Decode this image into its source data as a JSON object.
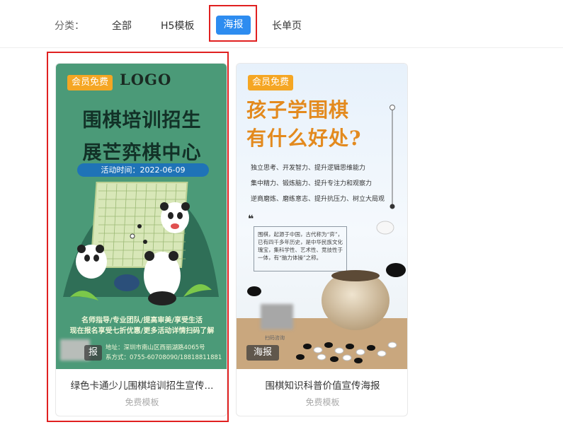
{
  "filter": {
    "label": "分类：",
    "tabs": [
      "全部",
      "H5模板",
      "海报",
      "长单页"
    ],
    "active": "海报"
  },
  "colors": {
    "accent": "#2d8cf0",
    "highlight": "#e02020",
    "badge": "#f5a623"
  },
  "cards": [
    {
      "badge": "会员免费",
      "type_tag": "报",
      "title": "绿色卡通少儿围棋培训招生宣传...",
      "subtitle": "免费模板",
      "poster": {
        "logo": "LOGO",
        "title_line1": "围棋培训招生",
        "title_line2": "展芒弈棋中心",
        "date": "活动时间：2022-06-09",
        "desc_line1": "名师指导/专业团队/提高审美/享受生活",
        "desc_line2": "现在报名享受七折优惠/更多活动详情扫码了解",
        "info_line1": "地址：深圳市南山区西丽湖路4065号",
        "info_line2": "系方式：0755-60708090/18818811881"
      }
    },
    {
      "badge": "会员免费",
      "type_tag": "海报",
      "title": "围棋知识科普价值宣传海报",
      "subtitle": "免费模板",
      "poster": {
        "title_line1": "孩子学围棋",
        "title_line2": "有什么好处?",
        "line1": "独立思考、开发智力、提升逻辑思维能力",
        "line2": "集中精力、锻炼脑力、提升专注力和观察力",
        "line3": "逆商磨炼、磨练意志、提升抗压力、树立大局观",
        "quote": "❝",
        "paragraph": "围棋，起源于中国，古代称为“弈”，已有四千多年历史，是中华民族文化瑰宝，集科学性、艺术性、竞技性于一体，有“脑力体操”之称。",
        "scan_text": "扫码咨询"
      }
    }
  ]
}
